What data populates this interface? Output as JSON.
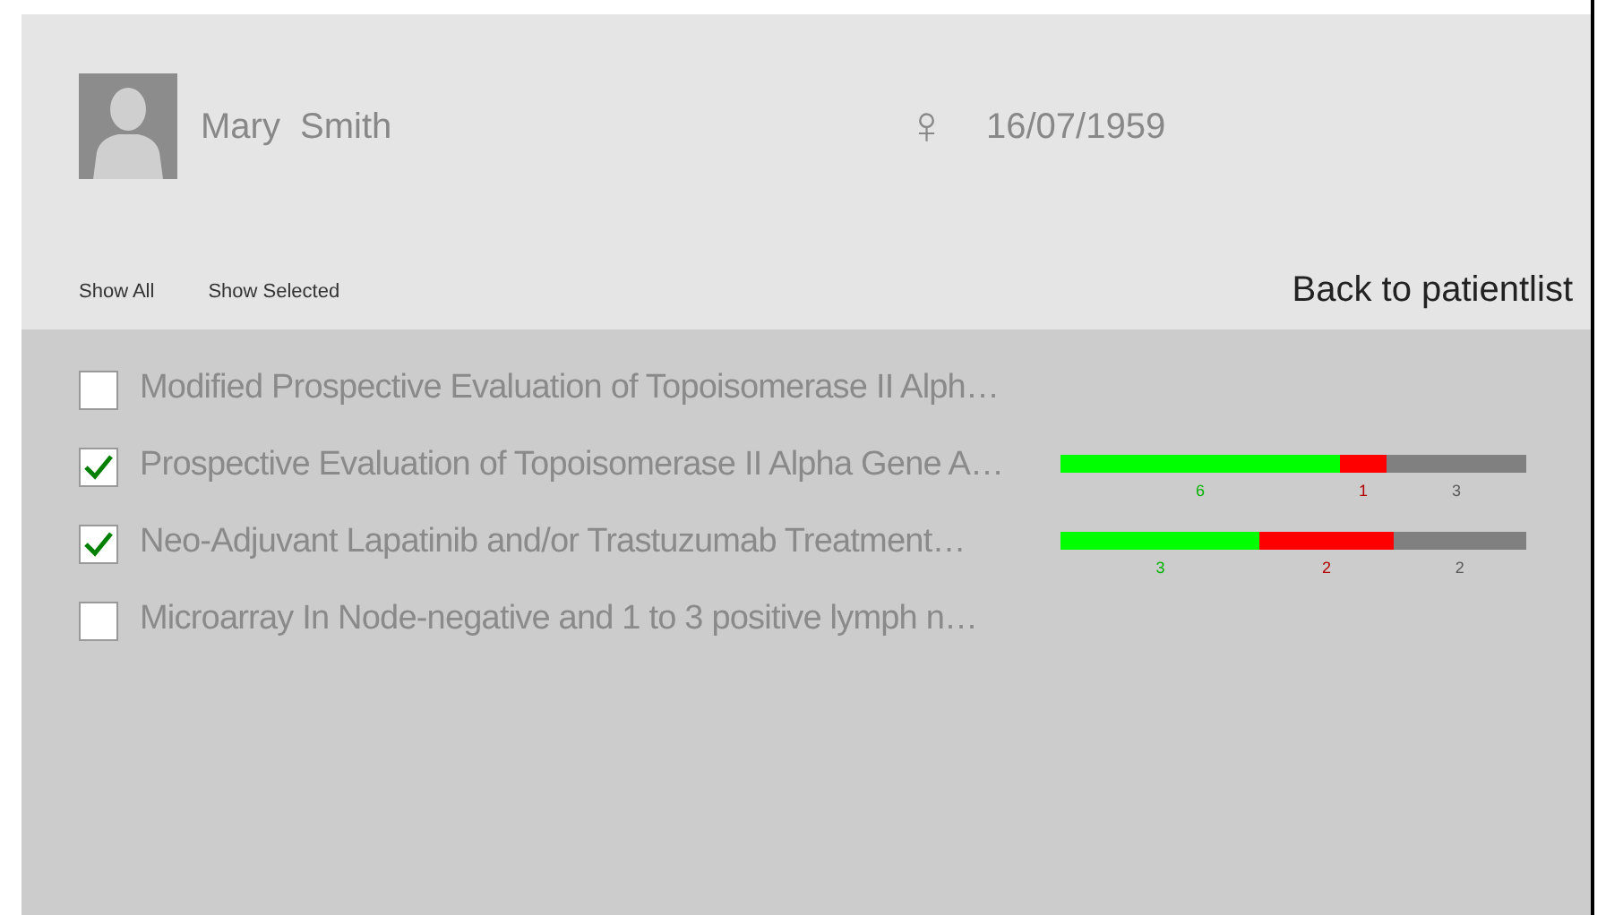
{
  "patient": {
    "first_name": "Mary",
    "last_name": "Smith",
    "gender_symbol": "♀",
    "birth_date": "16/07/1959"
  },
  "filters": [
    {
      "label": "Show All"
    },
    {
      "label": "Show Selected"
    }
  ],
  "back_link": "Back to patientlist",
  "trials": [
    {
      "title": "Modified Prospective Evaluation of Topoisomerase II Alph…",
      "checked": false
    },
    {
      "title": "Prospective Evaluation of Topoisomerase II Alpha Gene A…",
      "checked": true,
      "segments": [
        {
          "count": "6",
          "color": "#00ff00"
        },
        {
          "count": "1",
          "color": "#ff0000"
        },
        {
          "count": "3",
          "color": "#808080"
        }
      ]
    },
    {
      "title": "Neo-Adjuvant Lapatinib and/or Trastuzumab Treatment…",
      "checked": true,
      "segments": [
        {
          "count": "3",
          "color": "#00ff00"
        },
        {
          "count": "2",
          "color": "#ff0000"
        },
        {
          "count": "2",
          "color": "#808080"
        }
      ]
    },
    {
      "title": "Microarray In Node-negative and 1 to 3 positive lymph n…",
      "checked": false
    }
  ]
}
